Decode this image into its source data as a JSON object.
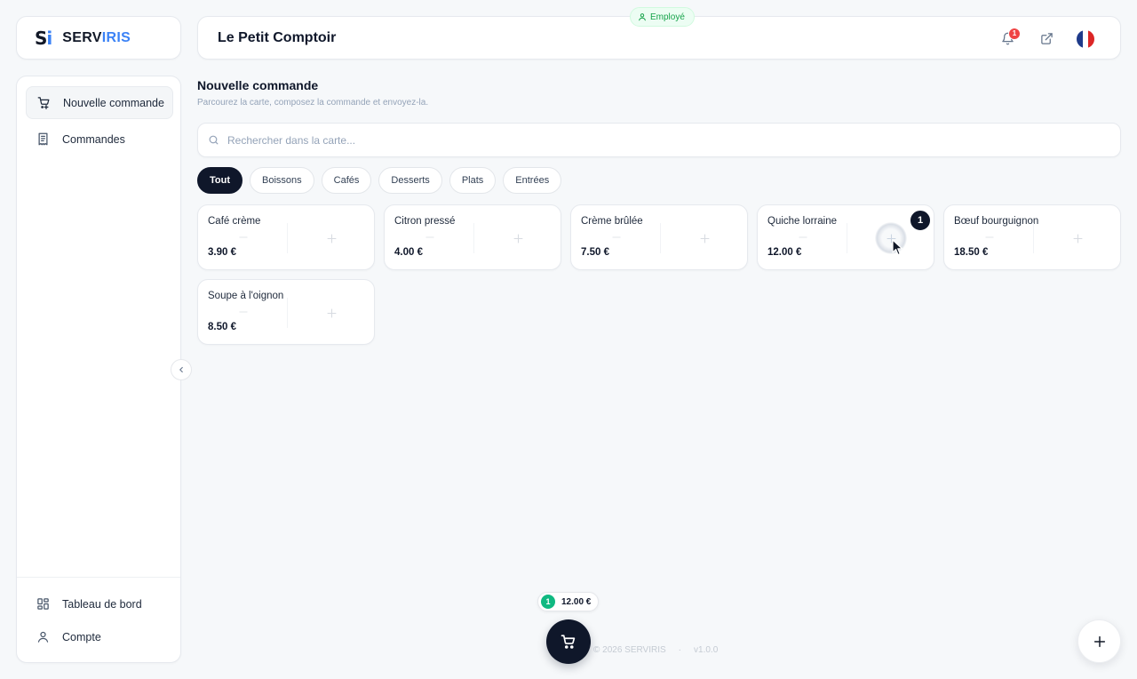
{
  "brand": {
    "mark_s": "S",
    "mark_i": "i",
    "name_a": "SERV",
    "name_b": "IRIS",
    "accent": "#3b82f6"
  },
  "header": {
    "title": "Le Petit Comptoir",
    "role_badge": "Employé",
    "notification_count": "1",
    "icons": [
      "bell-icon",
      "external-link-icon",
      "flag-fr-icon"
    ]
  },
  "sidebar": {
    "top_items": [
      {
        "label": "Nouvelle commande",
        "icon": "cart-plus-icon",
        "active": true
      },
      {
        "label": "Commandes",
        "icon": "receipt-icon",
        "active": false
      }
    ],
    "bottom_items": [
      {
        "label": "Tableau de bord",
        "icon": "dashboard-icon"
      },
      {
        "label": "Compte",
        "icon": "user-icon"
      }
    ]
  },
  "main": {
    "title": "Nouvelle commande",
    "subtitle": "Parcourez la carte, composez la commande et envoyez-la.",
    "search_placeholder": "Rechercher dans la carte...",
    "categories": [
      "Tout",
      "Boissons",
      "Cafés",
      "Desserts",
      "Plats",
      "Entrées"
    ],
    "active_category": "Tout",
    "products": [
      {
        "name": "Café crème",
        "price": "3.90 €",
        "qty": 0
      },
      {
        "name": "Citron pressé",
        "price": "4.00 €",
        "qty": 0
      },
      {
        "name": "Crème brûlée",
        "price": "7.50 €",
        "qty": 0
      },
      {
        "name": "Quiche lorraine",
        "price": "12.00 €",
        "qty": 1
      },
      {
        "name": "Bœuf bourguignon",
        "price": "18.50 €",
        "qty": 0
      },
      {
        "name": "Soupe à l'oignon",
        "price": "8.50 €",
        "qty": 0
      }
    ]
  },
  "cart": {
    "count": "1",
    "total": "12.00 €"
  },
  "footer": {
    "copyright": "© 2026 SERVIRIS",
    "separator": "·",
    "version": "v1.0.0"
  },
  "colors": {
    "dark": "#0f172a",
    "success": "#10b981",
    "danger": "#ef4444"
  }
}
